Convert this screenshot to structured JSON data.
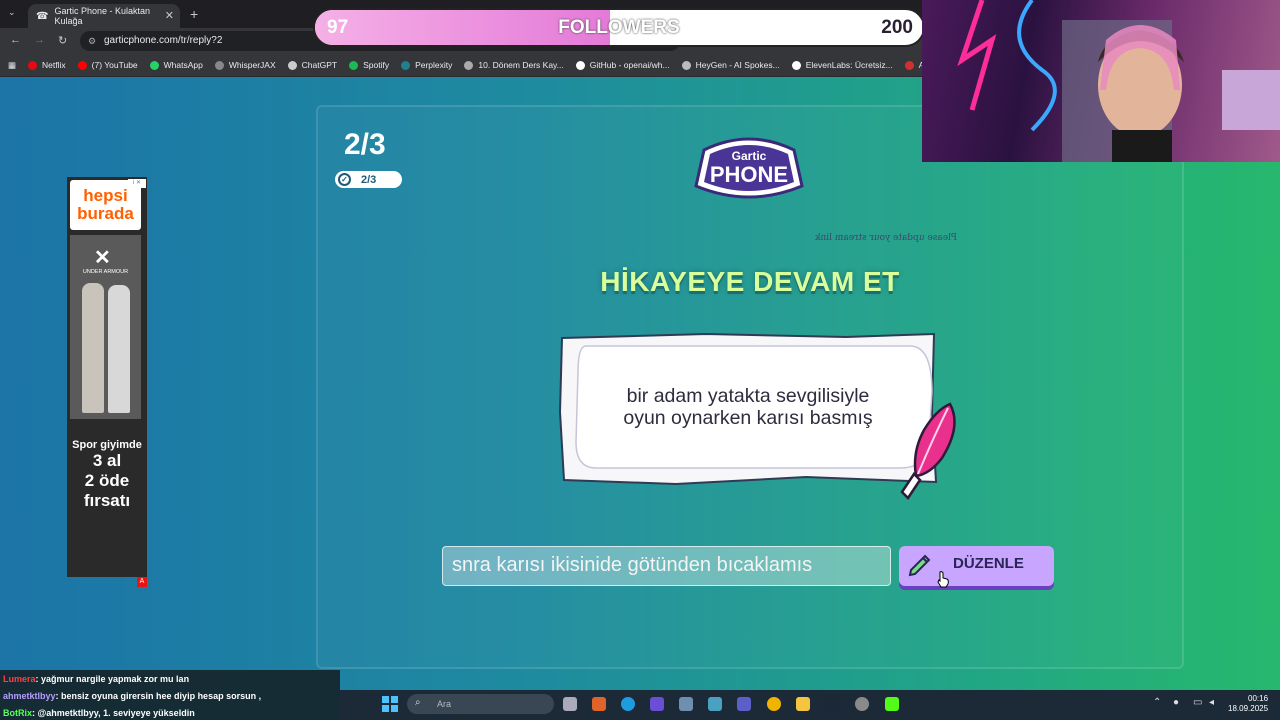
{
  "browser": {
    "tab_title": "Gartic Phone - Kulaktan Kulağa",
    "url": "garticphone.com/tr/reply?2",
    "bookmarks": [
      {
        "label": "Netflix",
        "color": "#e50914"
      },
      {
        "label": "(7) YouTube",
        "color": "#ff0000"
      },
      {
        "label": "WhatsApp",
        "color": "#25d366"
      },
      {
        "label": "WhisperJAX",
        "color": "#888888"
      },
      {
        "label": "ChatGPT",
        "color": "#cccccc"
      },
      {
        "label": "Spotify",
        "color": "#1db954"
      },
      {
        "label": "Perplexity",
        "color": "#20808d"
      },
      {
        "label": "10. Dönem Ders Kay...",
        "color": "#aaaaaa"
      },
      {
        "label": "GitHub - openai/wh...",
        "color": "#ffffff"
      },
      {
        "label": "HeyGen - AI Spokes...",
        "color": "#bbbbbb"
      },
      {
        "label": "ElevenLabs: Ücretsiz...",
        "color": "#ffffff"
      },
      {
        "label": "Audio Editin",
        "color": "#d03030"
      }
    ]
  },
  "followers": {
    "current": "97",
    "label": "FOLLOWERS",
    "goal": "200",
    "progress": 0.485
  },
  "game": {
    "round": "2/3",
    "round_pill": "2/3",
    "logo_top": "Gartic",
    "logo_bottom": "PHONE",
    "stream_note": "Please update your stream link",
    "heading": "HİKAYEYE DEVAM ET",
    "story_line1": "bir adam yatakta sevgilisiyle",
    "story_line2": "oyun oynarken karısı basmış",
    "reply_value": "snra karısı ikisinide götünden bıcaklamıs",
    "edit_button": "DÜZENLE"
  },
  "ad": {
    "brand_line1": "hepsi",
    "brand_line2": "burada",
    "sponsor": "UNDER ARMOUR",
    "promo_small": "Spor giyimde",
    "promo_line1": "3 al",
    "promo_line2": "2 öde",
    "promo_line3": "fırsatı"
  },
  "chat": [
    {
      "user": "Lumera",
      "text": ": yağmur nargile yapmak zor mu lan",
      "color": "#ff4040"
    },
    {
      "user": "ahmetktlbyy",
      "text": ": bensiz oyuna girersin hee diyip hesap sorsun ,",
      "color": "#b59cff"
    },
    {
      "user": "BotRix",
      "text": ": @ahmetktlbyy, 1. seviyeye yükseldin",
      "color": "#5cff5c"
    }
  ],
  "taskbar": {
    "search_placeholder": "Ara",
    "time": "00:16",
    "date": "18.09.2025"
  }
}
